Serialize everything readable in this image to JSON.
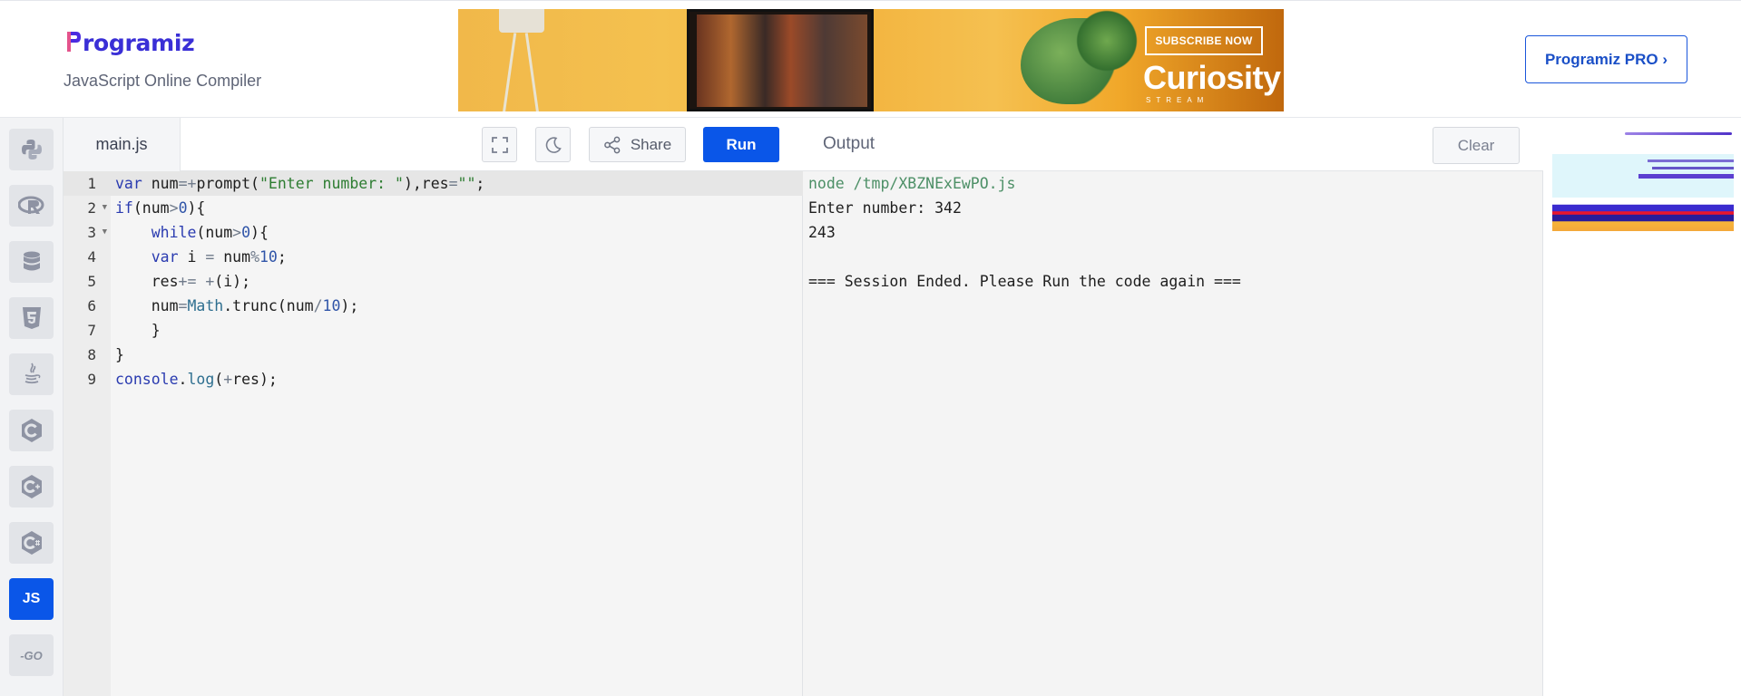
{
  "header": {
    "logo_text": "rogramiz",
    "subtitle": "JavaScript Online Compiler",
    "pro_button": "Programiz PRO ›",
    "ad": {
      "subscribe": "SUBSCRIBE NOW",
      "brand": "Curiosity",
      "brand_sub": "STREAM"
    }
  },
  "rail": {
    "items": [
      {
        "name": "python",
        "icon": "python-icon"
      },
      {
        "name": "r",
        "icon": "r-icon"
      },
      {
        "name": "sql",
        "icon": "database-icon"
      },
      {
        "name": "html",
        "icon": "html5-icon"
      },
      {
        "name": "java",
        "icon": "java-icon"
      },
      {
        "name": "c",
        "icon": "c-icon"
      },
      {
        "name": "cpp",
        "icon": "cpp-icon"
      },
      {
        "name": "csharp",
        "icon": "csharp-icon"
      },
      {
        "name": "javascript",
        "label": "JS",
        "active": true
      },
      {
        "name": "go",
        "label": "-GO"
      }
    ]
  },
  "editor": {
    "filename": "main.js",
    "share_label": "Share",
    "run_label": "Run",
    "lines": [
      "var num=+prompt(\"Enter number: \"),res=\"\";",
      "if(num>0){",
      "    while(num>0){",
      "    var i = num%10;",
      "    res+= +(i);",
      "    num=Math.trunc(num/10);",
      "    }",
      "}",
      "console.log(+res);"
    ],
    "line_numbers": [
      "1",
      "2",
      "3",
      "4",
      "5",
      "6",
      "7",
      "8",
      "9"
    ]
  },
  "output": {
    "title": "Output",
    "clear_label": "Clear",
    "lines": [
      "node /tmp/XBZNExEwPO.js",
      "Enter number: 342",
      "243",
      "",
      "=== Session Ended. Please Run the code again ==="
    ]
  },
  "colors": {
    "accent": "#0a56e8",
    "logo": "#3a2fd6"
  }
}
